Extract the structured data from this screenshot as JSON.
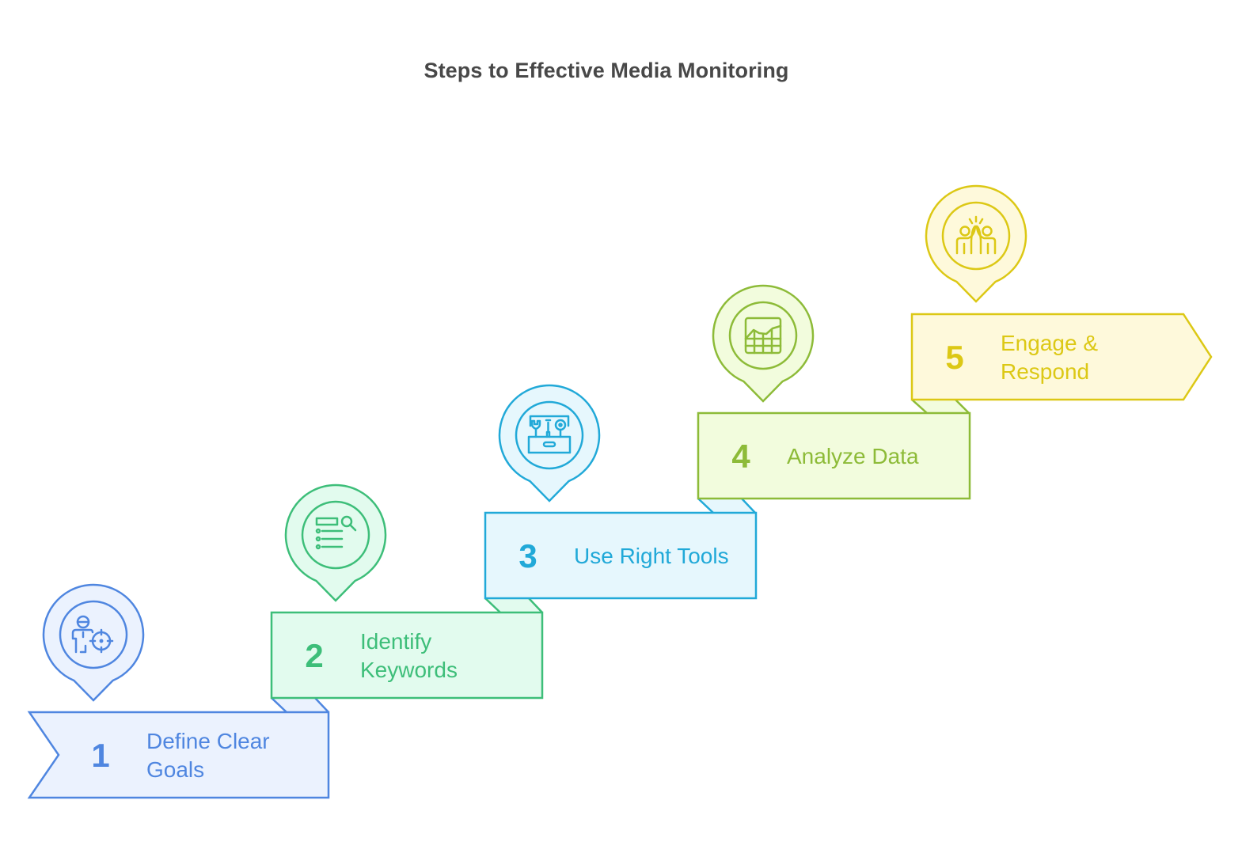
{
  "title": "Steps to Effective Media Monitoring",
  "steps": [
    {
      "number": "1",
      "label_lines": [
        "Define Clear",
        "Goals"
      ],
      "icon": "person-target-icon",
      "stroke": "#4F86E0",
      "fill": "#EBF2FE",
      "text": "#4F86E0"
    },
    {
      "number": "2",
      "label_lines": [
        "Identify",
        "Keywords"
      ],
      "icon": "list-search-icon",
      "stroke": "#3DBE79",
      "fill": "#E2FBEE",
      "text": "#3DBE79"
    },
    {
      "number": "3",
      "label_lines": [
        "Use Right Tools"
      ],
      "icon": "toolbox-icon",
      "stroke": "#21A9D8",
      "fill": "#E6F7FD",
      "text": "#21A9D8"
    },
    {
      "number": "4",
      "label_lines": [
        "Analyze Data"
      ],
      "icon": "chart-table-icon",
      "stroke": "#8DBB38",
      "fill": "#F2FCDD",
      "text": "#8DBB38"
    },
    {
      "number": "5",
      "label_lines": [
        "Engage &",
        "Respond"
      ],
      "icon": "high-five-icon",
      "stroke": "#DCC815",
      "fill": "#FEF9DB",
      "text": "#DCC815"
    }
  ]
}
